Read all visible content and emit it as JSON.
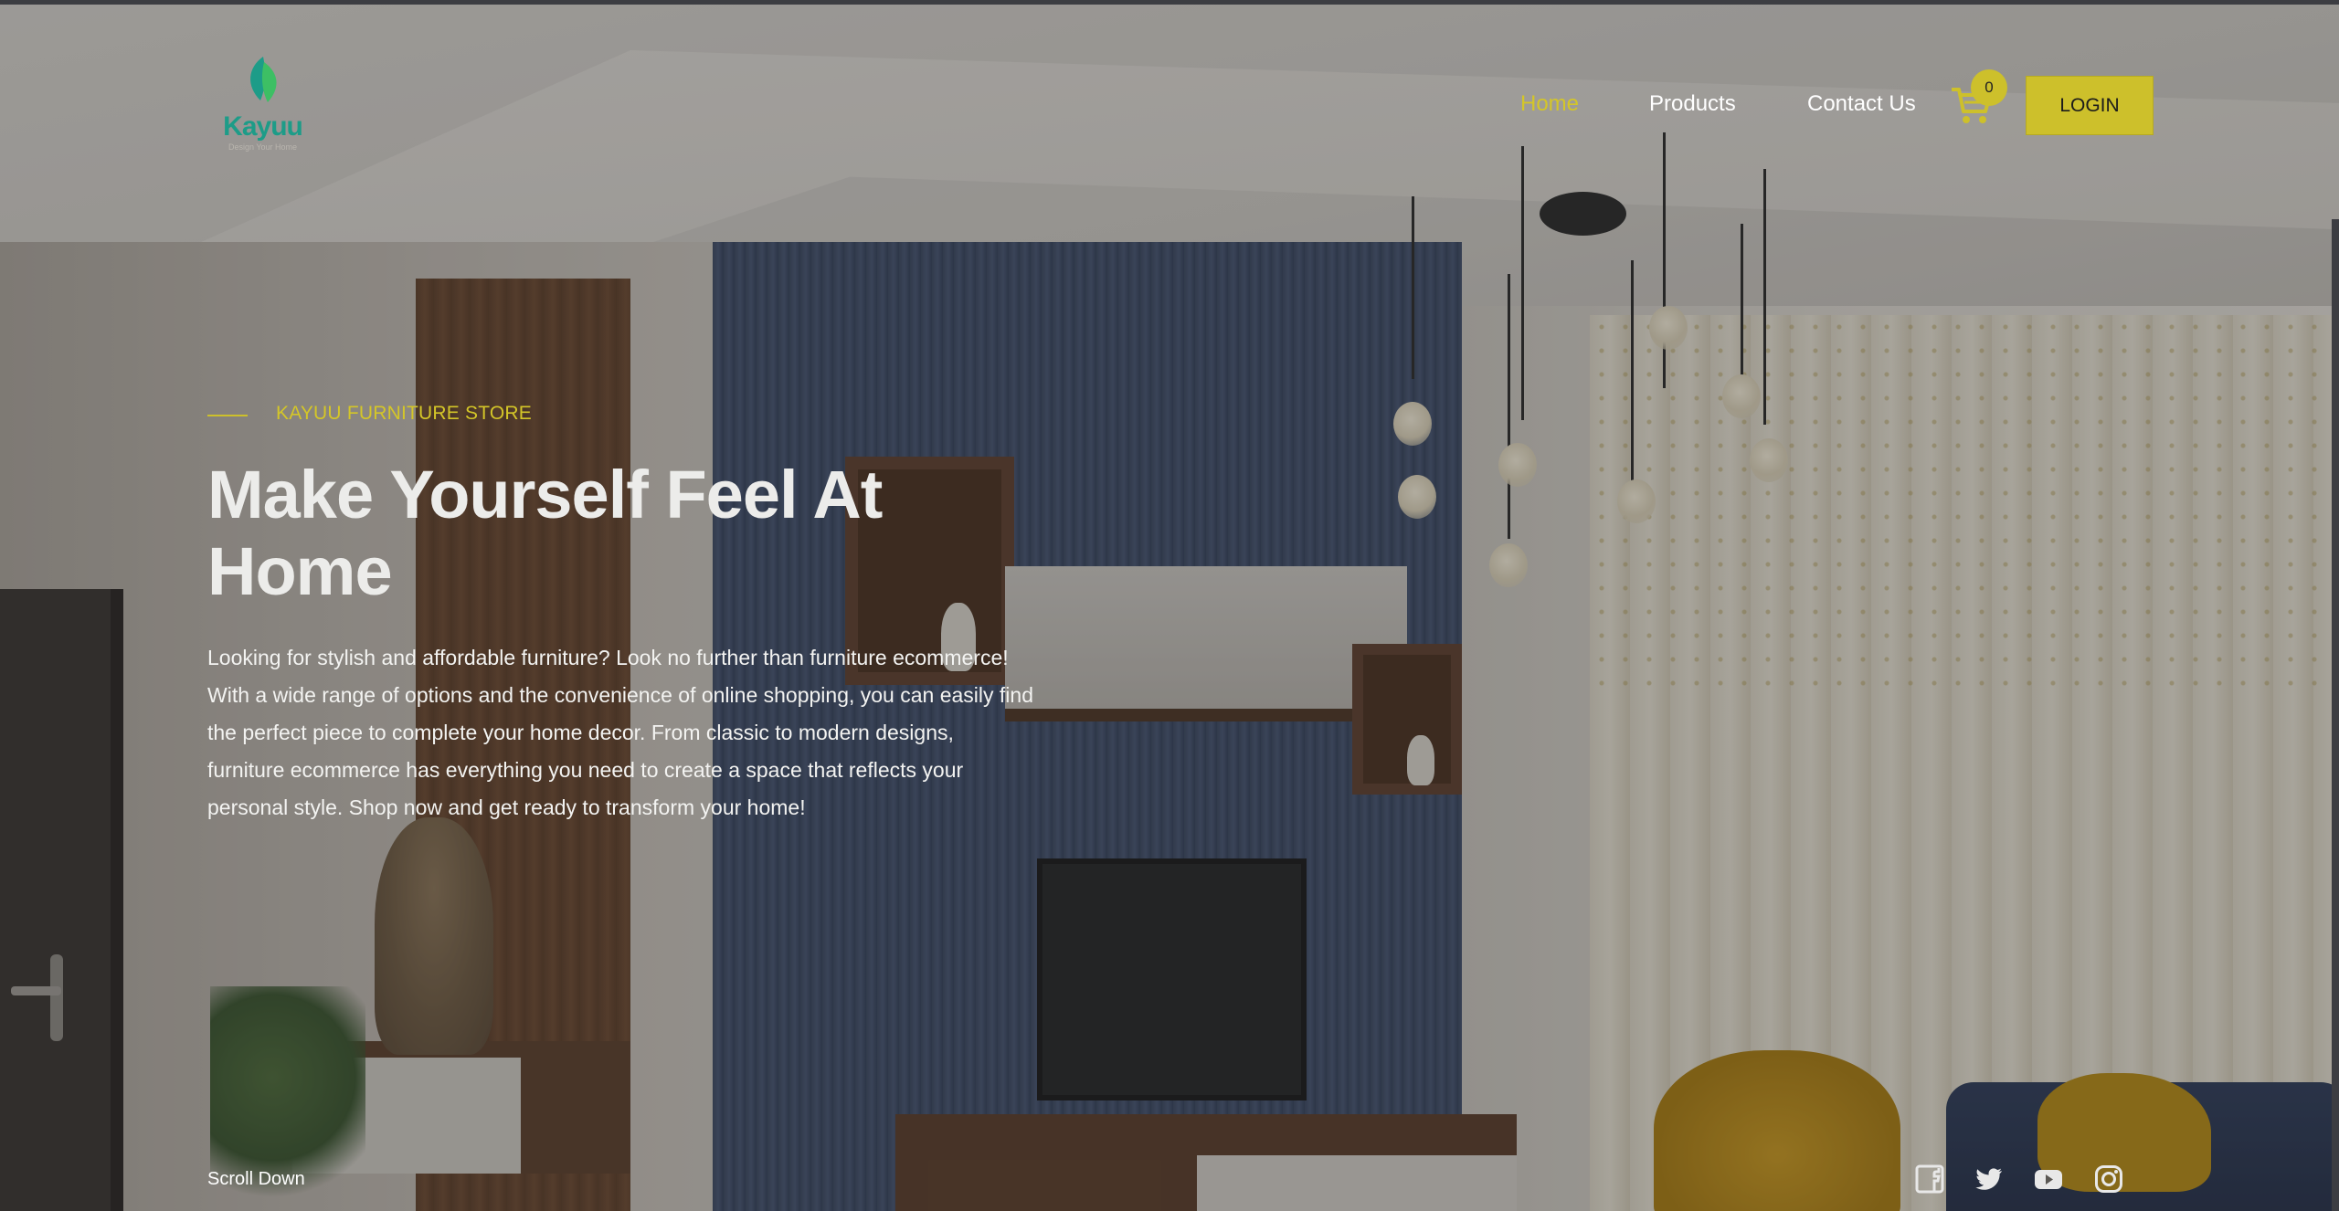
{
  "brand": {
    "name": "Kayuu",
    "tagline": "Design Your Home",
    "accent_color": "#cdc02b",
    "logo_color": "#1d9c88"
  },
  "nav": {
    "items": [
      {
        "label": "Home",
        "active": true
      },
      {
        "label": "Products",
        "active": false
      },
      {
        "label": "Contact Us",
        "active": false
      }
    ],
    "cart_icon": "cart-icon",
    "cart_count": "0",
    "login_label": "LOGIN"
  },
  "hero": {
    "eyebrow": "KAYUU FURNITURE STORE",
    "title": "Make Yourself Feel At Home",
    "description": "Looking for stylish and affordable furniture? Look no further than furniture ecommerce! With a wide range of options and the convenience of online shopping, you can easily find the perfect piece to complete your home decor. From classic to modern designs, furniture ecommerce has everything you need to create a space that reflects your personal style. Shop now and get ready to transform your home!"
  },
  "footer": {
    "scroll_label": "Scroll Down",
    "social": [
      "facebook-icon",
      "twitter-icon",
      "youtube-icon",
      "instagram-icon"
    ]
  }
}
